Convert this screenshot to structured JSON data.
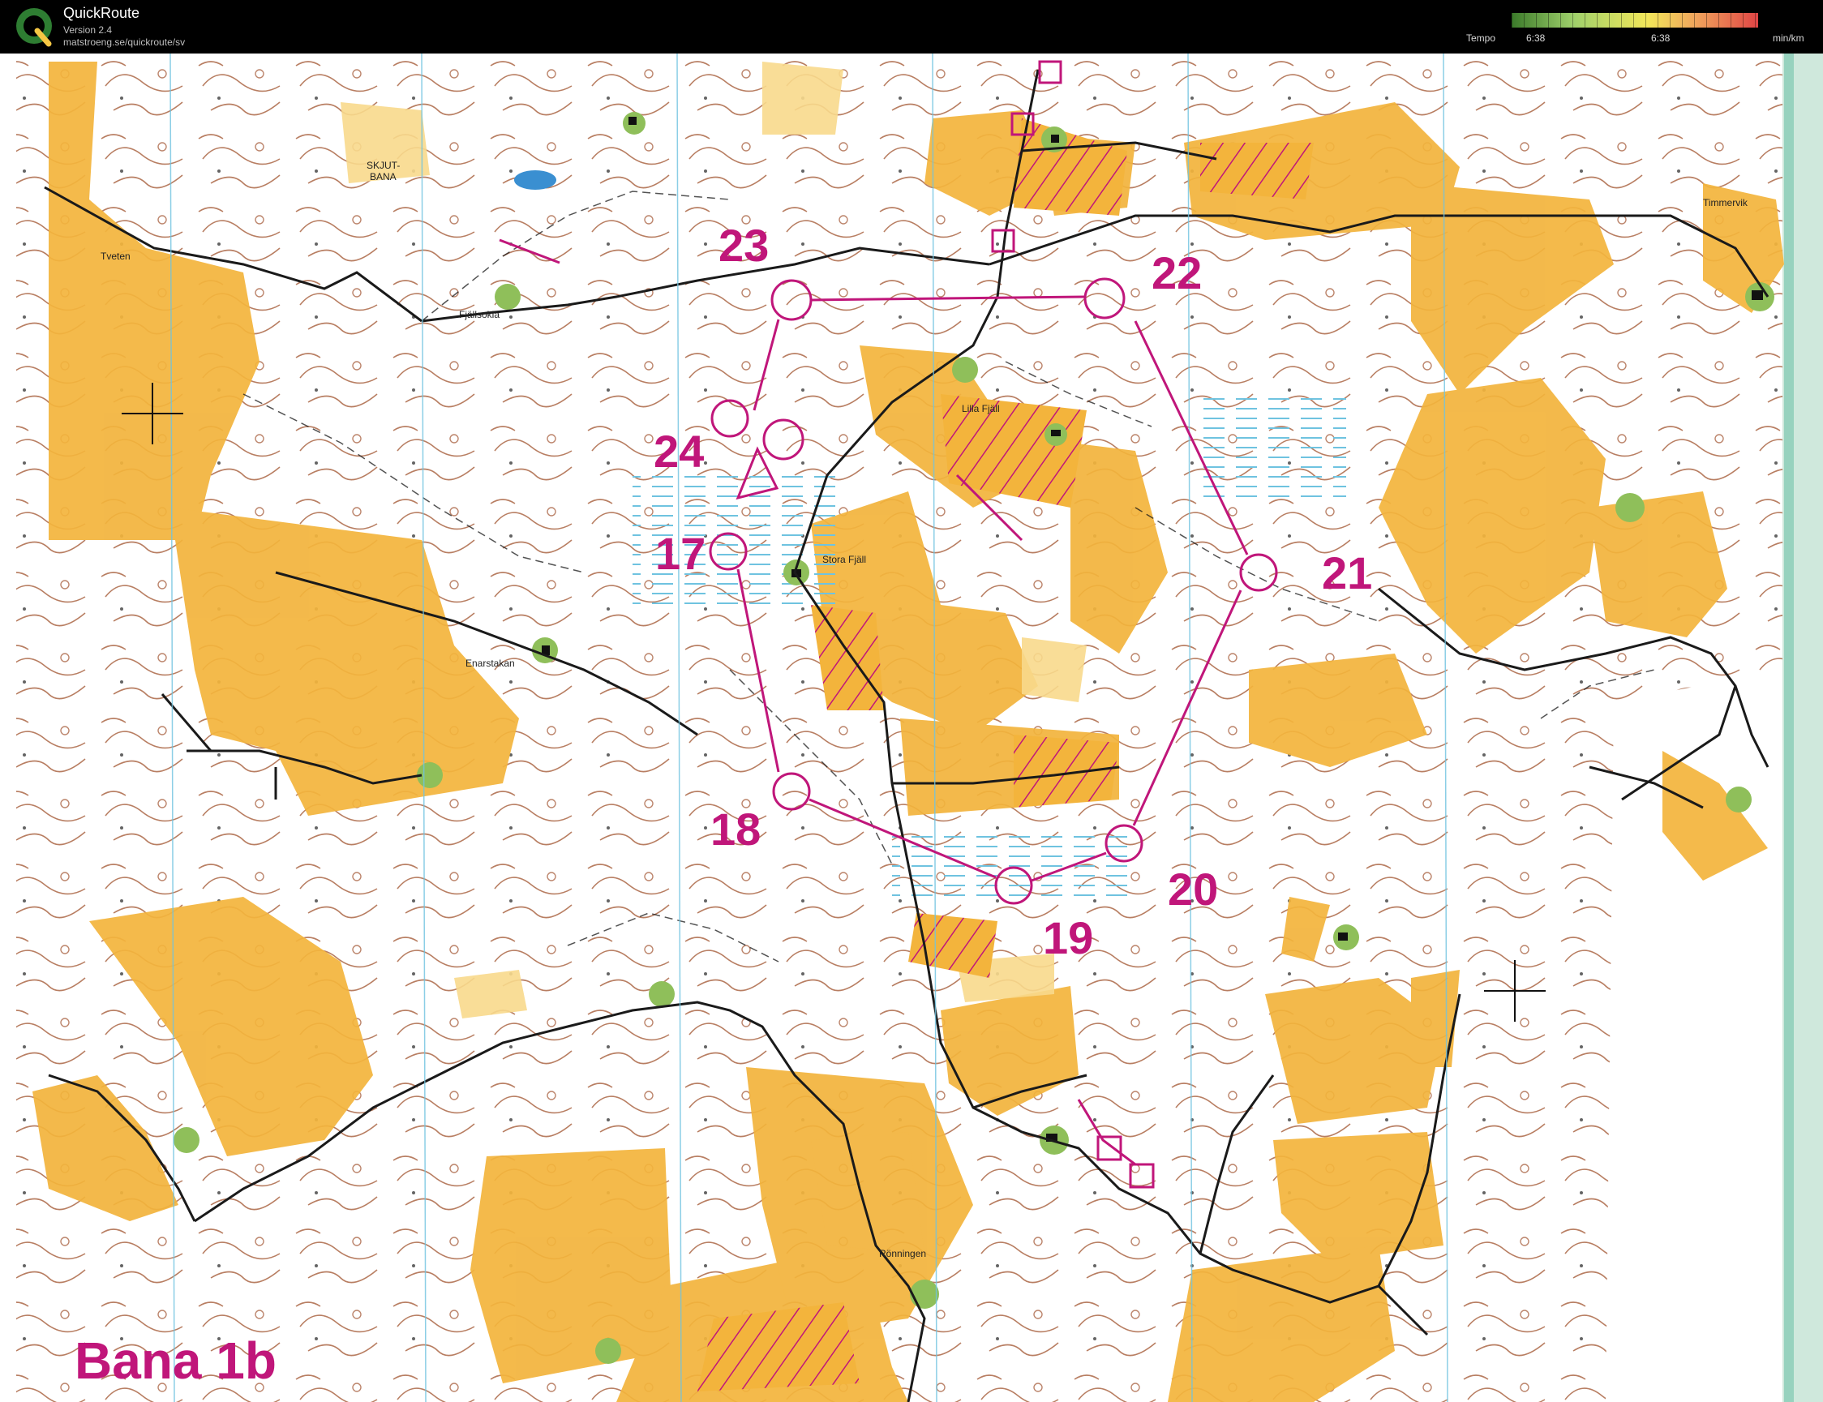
{
  "header": {
    "app_name": "QuickRoute",
    "version": "Version 2.4",
    "url": "matstroeng.se/quickroute/sv",
    "logo_letter": "Q"
  },
  "legend": {
    "label": "Tempo",
    "value_left": "6:38",
    "value_mid": "6:38",
    "unit": "min/km"
  },
  "map": {
    "course_label": "Bana 1b",
    "place_names": {
      "tveten": "Tveten",
      "skjutbana_1": "SKJUT-",
      "skjutbana_2": "BANA",
      "fjallsokla": "Fjällsokla",
      "lilla_fjall": "Lilla Fjäll",
      "stora_fjall": "Stora Fjäll",
      "enarstakan": "Enarstakan",
      "timmervik": "Timmervik",
      "ronningen": "Rönningen"
    },
    "controls": {
      "c17": "17",
      "c18": "18",
      "c19": "19",
      "c20": "20",
      "c21": "21",
      "c22": "22",
      "c23": "23",
      "c24": "24"
    },
    "colors": {
      "open_land": "#f3b43c",
      "rough_open": "#f8d98c",
      "forest": "#ffffff",
      "contour": "#a0522d",
      "course": "#c0167a",
      "settlement": "#8fbf5a",
      "water": "#6fc3e0"
    }
  }
}
